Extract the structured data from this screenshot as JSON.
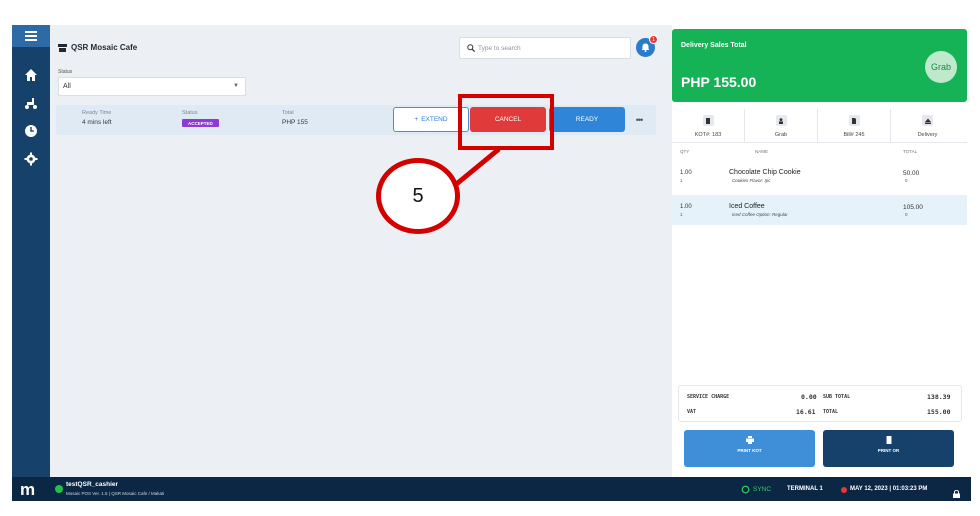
{
  "app": {
    "store_name": "QSR Mosaic Cafe"
  },
  "filters": {
    "status_label": "Status",
    "status_value": "All"
  },
  "search": {
    "placeholder": "Type to search"
  },
  "notifications": {
    "badge": "1"
  },
  "order": {
    "ready_time_label": "Ready Time",
    "ready_time_value": "4 mins left",
    "status_label": "Status",
    "status_value": "ACCEPTED",
    "total_label": "Total",
    "total_value": "PHP 155",
    "extend_label": "EXTEND",
    "cancel_label": "CANCEL",
    "ready_label": "READY",
    "more_label": "•••"
  },
  "callout": {
    "number": "5"
  },
  "summary": {
    "title": "Delivery Sales Total",
    "amount": "PHP 155.00",
    "channel_logo": "Grab"
  },
  "tabs": [
    {
      "label": "KOT#: 183",
      "icon": "receipt-icon"
    },
    {
      "label": "Grab",
      "icon": "person-icon"
    },
    {
      "label": "Bill# 245",
      "icon": "bill-icon"
    },
    {
      "label": "Delivery",
      "icon": "delivery-icon"
    }
  ],
  "table": {
    "headers": {
      "qty": "QTY",
      "name": "NAME",
      "total": "TOTAL"
    },
    "rows": [
      {
        "qty": "1.00",
        "qty_sub": "1",
        "name": "Chocolate Chip Cookie",
        "modifier": "Cookies Flavor: Ipc",
        "total": "50.00",
        "total_sub": "0"
      },
      {
        "qty": "1.00",
        "qty_sub": "1",
        "name": "Iced Coffee",
        "modifier": "Iced Coffee Option: Regular",
        "total": "105.00",
        "total_sub": "0"
      }
    ]
  },
  "totals": {
    "service_charge_label": "SERVICE CHARGE",
    "service_charge": "0.00",
    "vat_label": "VAT",
    "vat": "16.61",
    "subtotal_label": "SUB TOTAL",
    "subtotal": "138.39",
    "total_label": "TOTAL",
    "total": "155.00"
  },
  "actions": {
    "print_kot": "PRINT KOT",
    "print_or": "PRINT OR"
  },
  "footer": {
    "user": "testQSR_cashier",
    "version": "Mosaic POS Ver. 1.5 | QSR Mosaic Cafe / Makati",
    "sync": "SYNC",
    "terminal": "TERMINAL 1",
    "datetime": "MAY 12, 2023 | 01:03:23 PM",
    "logo": "m"
  },
  "colors": {
    "accent": "#16416b",
    "cancel": "#e03a3a",
    "ready": "#2f86d9",
    "summary": "#16b356",
    "status_tag": "#8e3bd6"
  }
}
